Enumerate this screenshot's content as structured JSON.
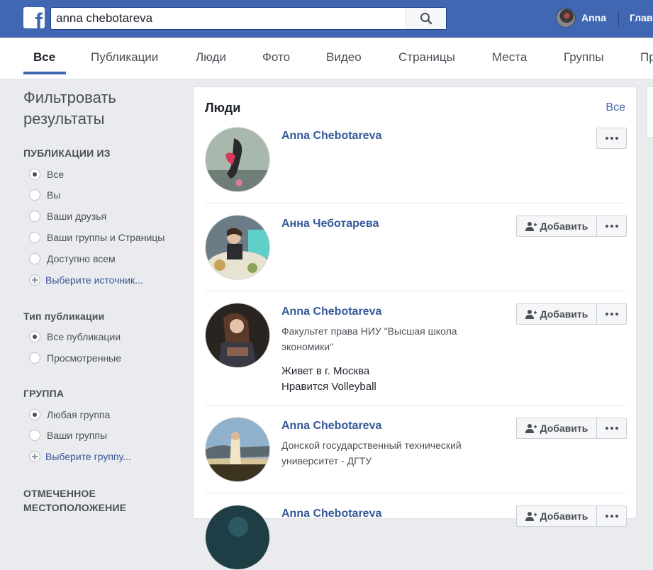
{
  "header": {
    "logo_letter": "f",
    "search_value": "anna chebotareva",
    "user_name": "Anna",
    "home_label": "Глав"
  },
  "tabs": [
    "Все",
    "Публикации",
    "Люди",
    "Фото",
    "Видео",
    "Страницы",
    "Места",
    "Группы",
    "Пр"
  ],
  "filters": {
    "title_line1": "Фильтровать",
    "title_line2": "результаты",
    "sections": {
      "publications_from": {
        "heading": "ПУБЛИКАЦИИ ИЗ",
        "options": [
          "Все",
          "Вы",
          "Ваши друзья",
          "Ваши группы и Страницы",
          "Доступно всем"
        ],
        "selected": "Все",
        "add_label": "Выберите источник..."
      },
      "post_type": {
        "heading": "Тип публикации",
        "options": [
          "Все публикации",
          "Просмотренные"
        ],
        "selected": "Все публикации"
      },
      "group": {
        "heading": "ГРУППА",
        "options": [
          "Любая группа",
          "Ваши группы"
        ],
        "selected": "Любая группа",
        "add_label": "Выберите группу..."
      },
      "location": {
        "heading_line1": "ОТМЕЧЕННОЕ",
        "heading_line2": "МЕСТОПОЛОЖЕНИЕ"
      }
    }
  },
  "people": {
    "title": "Люди",
    "see_all": "Все",
    "add_button_label": "Добавить",
    "results": [
      {
        "name": "Anna Chebotareva",
        "has_add": false
      },
      {
        "name": "Анна Чеботарева",
        "has_add": true
      },
      {
        "name": "Anna Chebotareva",
        "has_add": true,
        "desc_line1": "Факультет права НИУ \"Высшая школа",
        "desc_line2": "экономики\"",
        "lives": "Живет в г. Москва",
        "likes": "Нравится Volleyball"
      },
      {
        "name": "Anna Chebotareva",
        "has_add": true,
        "desc_line1": "Донской государственный технический",
        "desc_line2": "университет - ДГТУ"
      },
      {
        "name": "Anna Chebotareva",
        "has_add": true
      }
    ]
  },
  "colors": {
    "brand_blue": "#4267b2",
    "link_blue": "#365899",
    "page_bg": "#e9ebee"
  }
}
